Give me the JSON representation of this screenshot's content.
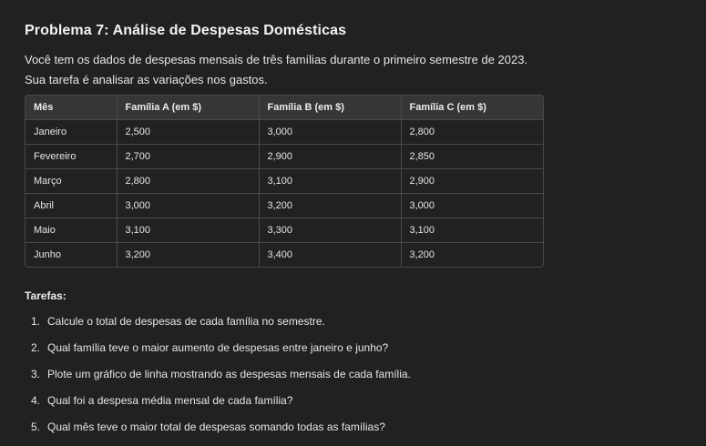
{
  "title": "Problema 7: Análise de Despesas Domésticas",
  "intro": "Você tem os dados de despesas mensais de três famílias durante o primeiro semestre de 2023. Sua tarefa é analisar as variações nos gastos.",
  "table": {
    "headers": [
      "Mês",
      "Família A (em $)",
      "Família B (em $)",
      "Família C (em $)"
    ],
    "rows": [
      [
        "Janeiro",
        "2,500",
        "3,000",
        "2,800"
      ],
      [
        "Fevereiro",
        "2,700",
        "2,900",
        "2,850"
      ],
      [
        "Março",
        "2,800",
        "3,100",
        "2,900"
      ],
      [
        "Abril",
        "3,000",
        "3,200",
        "3,000"
      ],
      [
        "Maio",
        "3,100",
        "3,300",
        "3,100"
      ],
      [
        "Junho",
        "3,200",
        "3,400",
        "3,200"
      ]
    ]
  },
  "tasks": {
    "heading": "Tarefas:",
    "items": [
      {
        "num": "1.",
        "text": "Calcule o total de despesas de cada família no semestre."
      },
      {
        "num": "2.",
        "text": "Qual família teve o maior aumento de despesas entre janeiro e junho?"
      },
      {
        "num": "3.",
        "text": "Plote um gráfico de linha mostrando as despesas mensais de cada família."
      },
      {
        "num": "4.",
        "text": "Qual foi a despesa média mensal de cada família?"
      },
      {
        "num": "5.",
        "text": "Qual mês teve o maior total de despesas somando todas as famílias?"
      }
    ]
  }
}
